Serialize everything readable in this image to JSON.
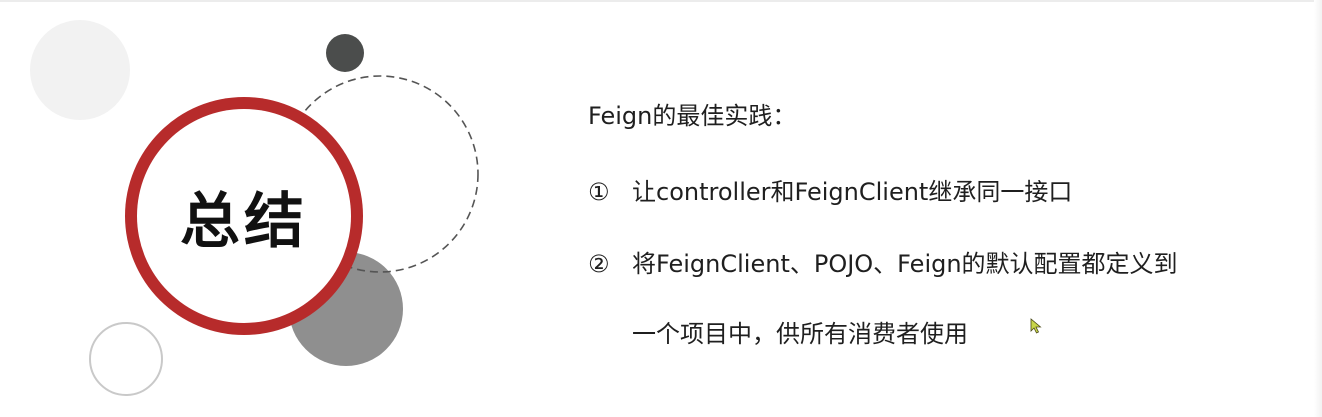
{
  "slide": {
    "title": "总结",
    "heading": "Feign的最佳实践：",
    "items": [
      {
        "number": "①",
        "text": "让controller和FeignClient继承同一接口"
      },
      {
        "number": "②",
        "text": "将FeignClient、POJO、Feign的默认配置都定义到",
        "continuation": "一个项目中，供所有消费者使用"
      }
    ]
  },
  "colors": {
    "ring_red": "#b72b2b",
    "dark_dot": "#4b4d4c",
    "gray_circle": "#8f8f8f",
    "light_circle": "#f2f2f2",
    "outline_circle": "#c9c9c9",
    "dashed_circle": "#555555",
    "cursor": "#c8d64a"
  },
  "icons": {
    "cursor": "mouse-pointer-icon"
  }
}
